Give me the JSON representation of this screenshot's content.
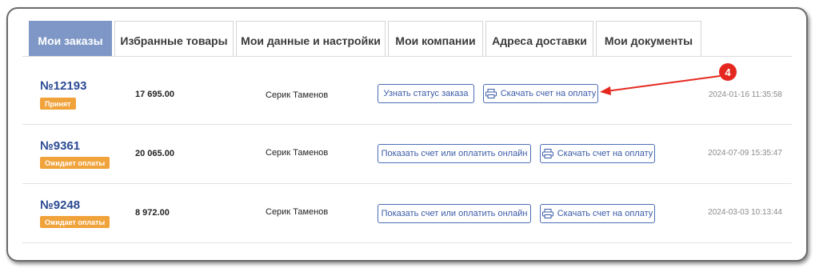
{
  "tabs": [
    {
      "label": "Мои заказы",
      "active": true
    },
    {
      "label": "Избранные товары",
      "active": false
    },
    {
      "label": "Мои данные и настройки",
      "active": false
    },
    {
      "label": "Мои компании",
      "active": false
    },
    {
      "label": "Адреса доставки",
      "active": false
    },
    {
      "label": "Мои документы",
      "active": false
    }
  ],
  "orders": [
    {
      "number": "№12193",
      "status": "Принят",
      "amount": "17 695.00",
      "customer": "Серик Таменов",
      "primary_action": "Узнать статус заказа",
      "download_action": "Скачать счет на оплату",
      "date": "2024-01-16 11:35:58"
    },
    {
      "number": "№9361",
      "status": "Ожидает оплаты",
      "amount": "20 065.00",
      "customer": "Серик Таменов",
      "primary_action": "Показать счет или оплатить онлайн",
      "download_action": "Скачать счет на оплату",
      "date": "2024-07-09 15:35:47"
    },
    {
      "number": "№9248",
      "status": "Ожидает оплаты",
      "amount": "8 972.00",
      "customer": "Серик Таменов",
      "primary_action": "Показать счет или оплатить онлайн",
      "download_action": "Скачать счет на оплату",
      "date": "2024-03-03 10:13:44"
    }
  ],
  "annotation": {
    "label": "4",
    "color": "#e5281f"
  },
  "colors": {
    "accent": "#7e97c6",
    "link": "#2b4a93",
    "badge": "#f0a23b",
    "button_border": "#4a6db6"
  },
  "icons": {
    "download": "printer-icon"
  }
}
